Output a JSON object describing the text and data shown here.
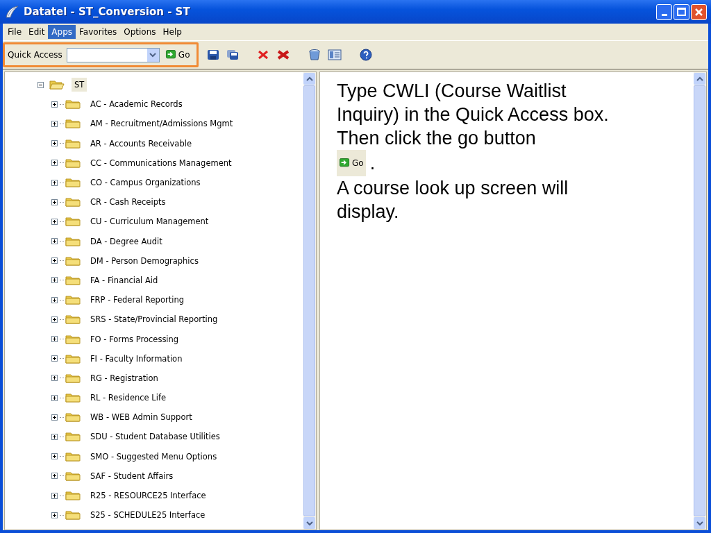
{
  "window": {
    "title": "Datatel - ST_Conversion - ST"
  },
  "menu": [
    {
      "label": "File",
      "selected": false
    },
    {
      "label": "Edit",
      "selected": false
    },
    {
      "label": "Apps",
      "selected": true
    },
    {
      "label": "Favorites",
      "selected": false
    },
    {
      "label": "Options",
      "selected": false
    },
    {
      "label": "Help",
      "selected": false
    }
  ],
  "quick_access": {
    "label": "Quick Access",
    "button": "Go",
    "highlighted": true
  },
  "tree": {
    "label": "ST",
    "expanded": true,
    "selected": true,
    "children": [
      {
        "label": "AC - Academic Records",
        "expanded": false,
        "selected": false
      },
      {
        "label": "AM - Recruitment/Admissions Mgmt",
        "expanded": false,
        "selected": false
      },
      {
        "label": "AR - Accounts Receivable",
        "expanded": false,
        "selected": false
      },
      {
        "label": "CC - Communications Management",
        "expanded": false,
        "selected": false
      },
      {
        "label": "CO - Campus Organizations",
        "expanded": false,
        "selected": false
      },
      {
        "label": "CR - Cash Receipts",
        "expanded": false,
        "selected": false
      },
      {
        "label": "CU - Curriculum Management",
        "expanded": false,
        "selected": false
      },
      {
        "label": "DA - Degree Audit",
        "expanded": false,
        "selected": false
      },
      {
        "label": "DM - Person Demographics",
        "expanded": false,
        "selected": false
      },
      {
        "label": "FA - Financial Aid",
        "expanded": false,
        "selected": false
      },
      {
        "label": "FRP - Federal Reporting",
        "expanded": false,
        "selected": false
      },
      {
        "label": "SRS - State/Provincial Reporting",
        "expanded": false,
        "selected": false
      },
      {
        "label": "FO - Forms Processing",
        "expanded": false,
        "selected": false
      },
      {
        "label": "FI - Faculty Information",
        "expanded": false,
        "selected": false
      },
      {
        "label": "RG - Registration",
        "expanded": false,
        "selected": false
      },
      {
        "label": "RL - Residence Life",
        "expanded": false,
        "selected": false
      },
      {
        "label": "WB - WEB Admin Support",
        "expanded": false,
        "selected": false
      },
      {
        "label": "SDU - Student Database Utilities",
        "expanded": false,
        "selected": false
      },
      {
        "label": "SMO - Suggested Menu Options",
        "expanded": false,
        "selected": false
      },
      {
        "label": "SAF - Student Affairs",
        "expanded": false,
        "selected": false
      },
      {
        "label": "R25 - RESOURCE25 Interface",
        "expanded": false,
        "selected": false
      },
      {
        "label": "S25 - SCHEDULE25 Interface",
        "expanded": false,
        "selected": false
      }
    ]
  },
  "instructions": [
    {
      "kind": "text",
      "text": "Type CWLI (Course Waitlist Inquiry) in the Quick Access box."
    },
    {
      "kind": "text",
      "text": "Then click the go button"
    },
    {
      "kind": "go_button",
      "button": "Go",
      "text": "."
    },
    {
      "kind": "text",
      "text": "A course look up screen will display."
    }
  ]
}
